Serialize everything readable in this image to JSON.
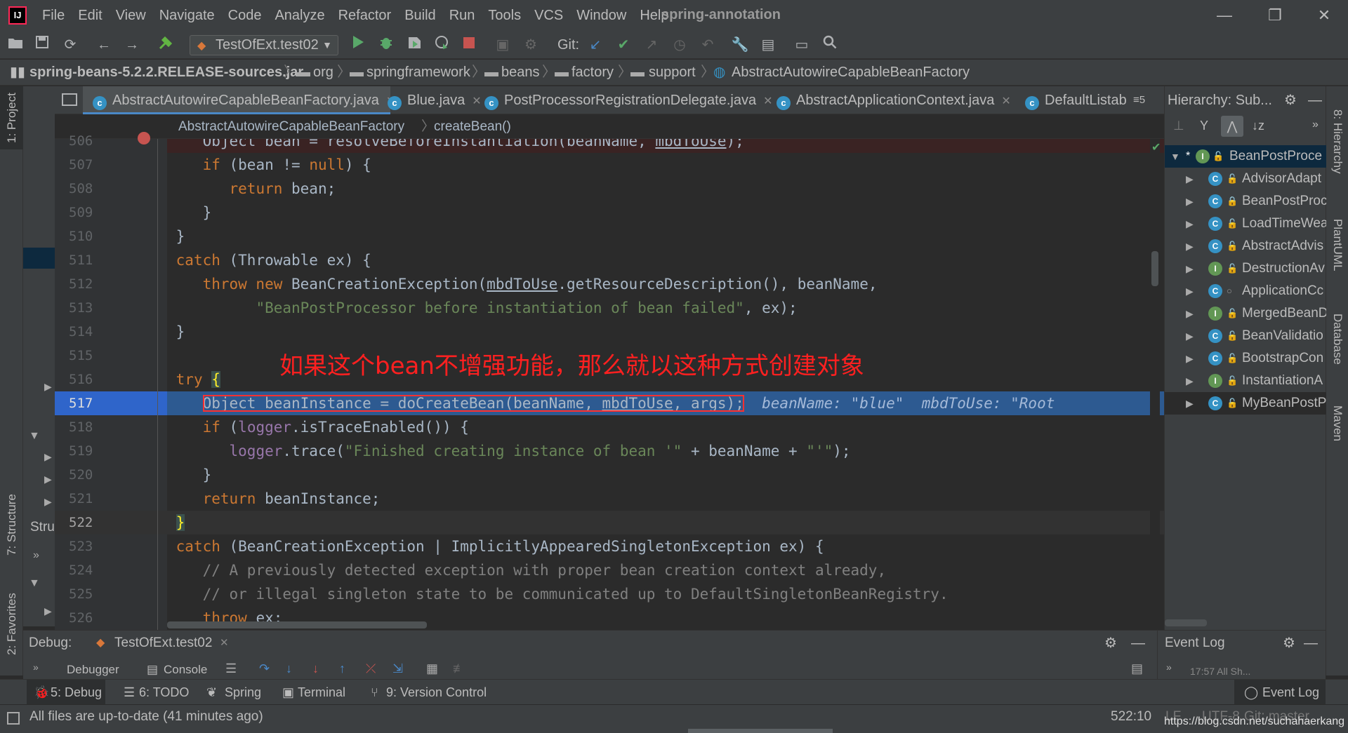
{
  "menubar": {
    "logo": "IJ",
    "items": [
      "File",
      "Edit",
      "View",
      "Navigate",
      "Code",
      "Analyze",
      "Refactor",
      "Build",
      "Run",
      "Tools",
      "VCS",
      "Window",
      "Help"
    ],
    "project": "spring-annotation",
    "minimize": "—",
    "restore": "❐",
    "close": "✕"
  },
  "toolbar": {
    "run_config": "TestOfExt.test02",
    "git_label": "Git:"
  },
  "navbar": {
    "crumbs": [
      "spring-beans-5.2.2.RELEASE-sources.jar",
      "org",
      "springframework",
      "beans",
      "factory",
      "support",
      "AbstractAutowireCapableBeanFactory"
    ]
  },
  "left_strip": {
    "project_tab": "1: Project",
    "structure_tab": "7: Structure",
    "favorites_tab": "2: Favorites",
    "structure_label": "Stru"
  },
  "right_strip": {
    "hierarchy_tab": "8: Hierarchy",
    "plantuml_tab": "PlantUML",
    "database_tab": "Database",
    "maven_tab": "Maven"
  },
  "editor_tabs": [
    {
      "label": "AbstractAutowireCapableBeanFactory.java",
      "active": true
    },
    {
      "label": "Blue.java",
      "active": false
    },
    {
      "label": "PostProcessorRegistrationDelegate.java",
      "active": false
    },
    {
      "label": "AbstractApplicationContext.java",
      "active": false
    },
    {
      "label": "DefaultListab",
      "active": false
    }
  ],
  "editor_tabs_overflow": "≡5",
  "editor_crumb": {
    "class": "AbstractAutowireCapableBeanFactory",
    "method": "createBean()"
  },
  "code": {
    "line_numbers": [
      "506",
      "507",
      "508",
      "509",
      "510",
      "511",
      "512",
      "513",
      "514",
      "515",
      "516",
      "517",
      "518",
      "519",
      "520",
      "521",
      "522",
      "523",
      "524",
      "525",
      "526"
    ],
    "annotation": "如果这个bean不增强功能，那么就以这种方式创建对象",
    "inline_hint": "beanName: \"blue\"  mbdToUse: \"Root",
    "current_line": "522"
  },
  "hierarchy": {
    "title": "Hierarchy:",
    "subtitle": "Sub...",
    "items": [
      {
        "label": "BeanPostProce",
        "icon": "I",
        "root": true
      },
      {
        "label": "AdvisorAdapt",
        "icon": "C"
      },
      {
        "label": "BeanPostProc",
        "icon": "C"
      },
      {
        "label": "LoadTimeWea",
        "icon": "C"
      },
      {
        "label": "AbstractAdvis",
        "icon": "C"
      },
      {
        "label": "DestructionAv",
        "icon": "I"
      },
      {
        "label": "ApplicationCc",
        "icon": "C"
      },
      {
        "label": "MergedBeanD",
        "icon": "I"
      },
      {
        "label": "BeanValidatio",
        "icon": "C"
      },
      {
        "label": "BootstrapCon",
        "icon": "C"
      },
      {
        "label": "InstantiationA",
        "icon": "I"
      },
      {
        "label": "MyBeanPostP",
        "icon": "C"
      }
    ]
  },
  "debug": {
    "label": "Debug:",
    "session": "TestOfExt.test02",
    "debugger_tab": "Debugger",
    "console_tab": "Console"
  },
  "event_log": {
    "title": "Event Log",
    "entry": "17:57  All Sh..."
  },
  "bottom_tools": [
    "5: Debug",
    "6: TODO",
    "Spring",
    "Terminal",
    "9: Version Control"
  ],
  "bottom_event_log": "Event Log",
  "status": {
    "message": "All files are up-to-date (41 minutes ago)",
    "position": "522:10",
    "le": "LF",
    "encoding": "UTF-8",
    "git": "Git: master",
    "watermark": "https://blog.csdn.net/suchahaerkang"
  }
}
